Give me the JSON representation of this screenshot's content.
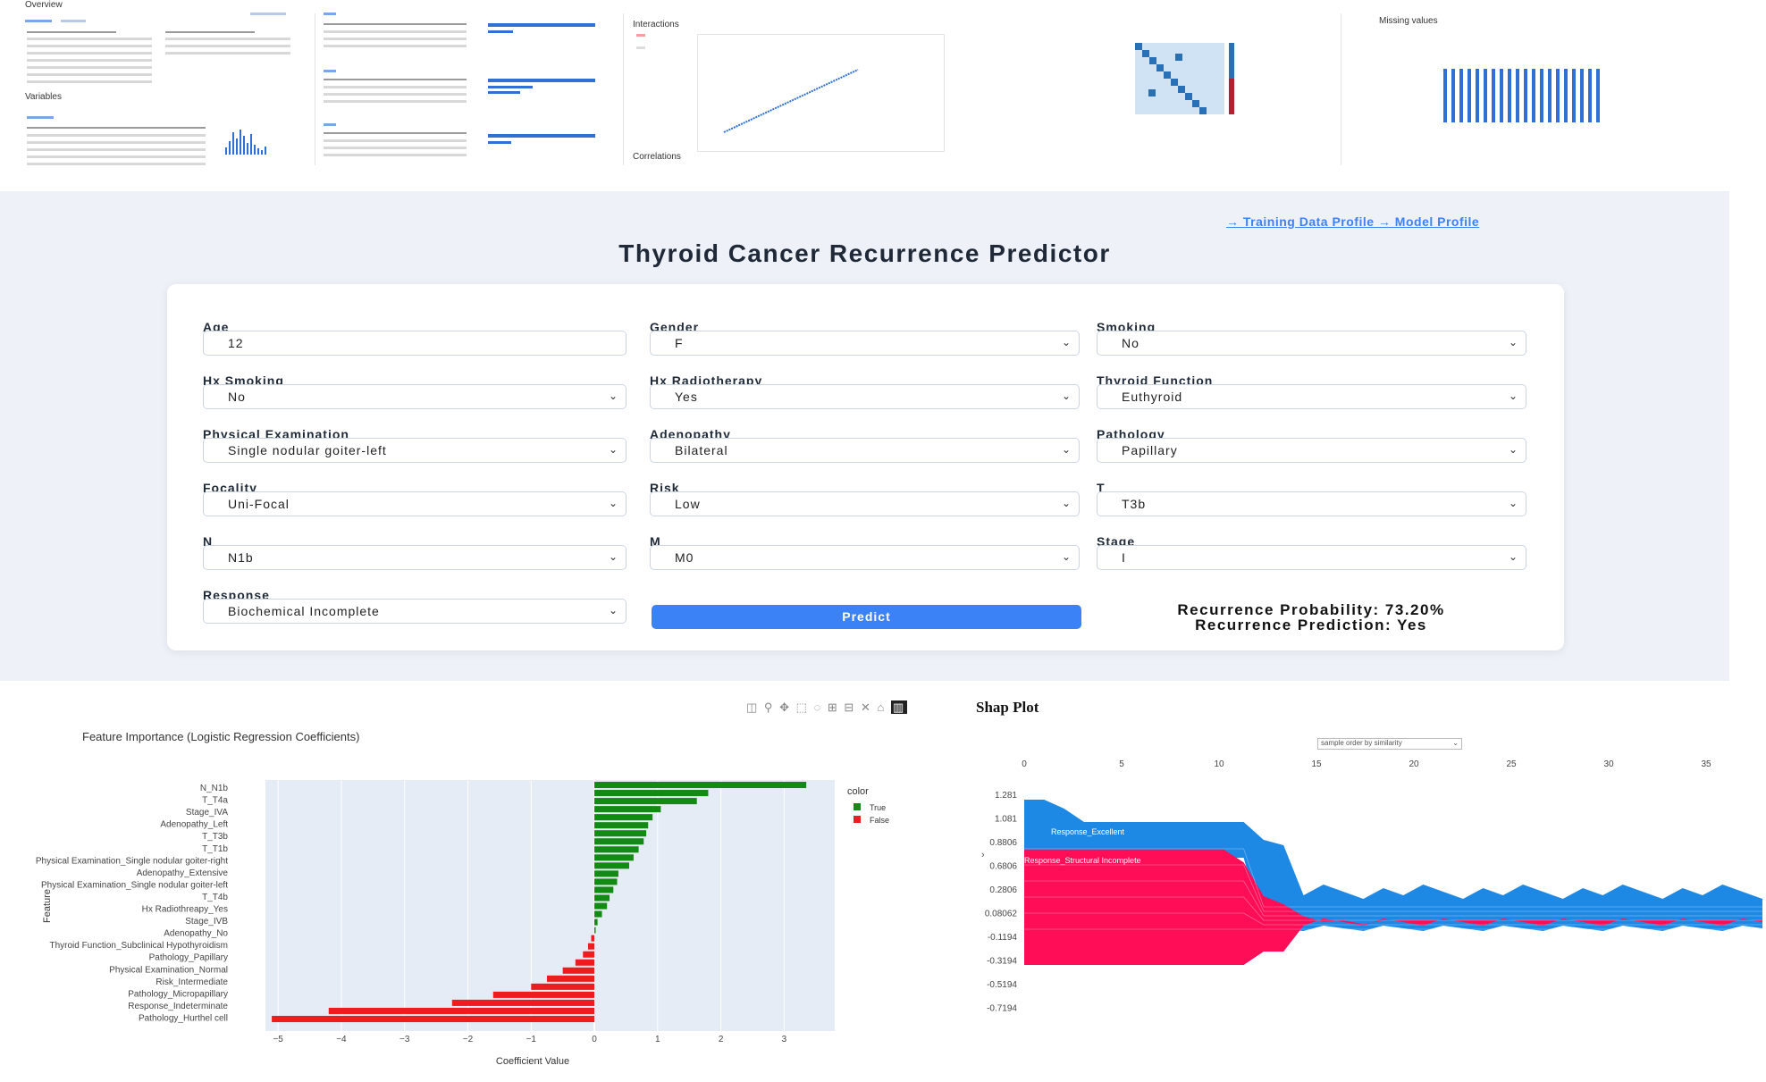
{
  "thumbnails": {
    "overview_title": "Overview",
    "variables_title": "Variables",
    "interactions_title": "Interactions",
    "correlations_title": "Correlations",
    "missing_title": "Missing values"
  },
  "header": {
    "nav_links": "→ Training Data Profile → Model Profile",
    "title": "Thyroid Cancer Recurrence Predictor"
  },
  "form": {
    "fields": [
      {
        "label": "Age",
        "value": "12",
        "type": "input"
      },
      {
        "label": "Gender",
        "value": "F",
        "type": "select"
      },
      {
        "label": "Smoking",
        "value": "No",
        "type": "select"
      },
      {
        "label": "Hx Smoking",
        "value": "No",
        "type": "select"
      },
      {
        "label": "Hx Radiotherapy",
        "value": "Yes",
        "type": "select"
      },
      {
        "label": "Thyroid Function",
        "value": "Euthyroid",
        "type": "select"
      },
      {
        "label": "Physical Examination",
        "value": "Single nodular goiter-left",
        "type": "select"
      },
      {
        "label": "Adenopathy",
        "value": "Bilateral",
        "type": "select"
      },
      {
        "label": "Pathology",
        "value": "Papillary",
        "type": "select"
      },
      {
        "label": "Focality",
        "value": "Uni-Focal",
        "type": "select"
      },
      {
        "label": "Risk",
        "value": "Low",
        "type": "select"
      },
      {
        "label": "T",
        "value": "T3b",
        "type": "select"
      },
      {
        "label": "N",
        "value": "N1b",
        "type": "select"
      },
      {
        "label": "M",
        "value": "M0",
        "type": "select"
      },
      {
        "label": "Stage",
        "value": "I",
        "type": "select"
      },
      {
        "label": "Response",
        "value": "Biochemical Incomplete",
        "type": "select"
      }
    ],
    "predict_label": "Predict",
    "result_probability": "Recurrence Probability: 73.20%",
    "result_prediction": "Recurrence Prediction: Yes"
  },
  "colors": {
    "accent": "#3b82f6",
    "panel_bg": "#eef2f8",
    "positive": "#138a13",
    "negative": "#ee1c1c",
    "shap_blue": "#1e88e5",
    "shap_red": "#ff0d57"
  },
  "chart_data": [
    {
      "type": "bar",
      "orientation": "horizontal",
      "title": "Feature Importance (Logistic Regression Coefficients)",
      "xlabel": "Coefficient Value",
      "ylabel": "Feature",
      "xlim": [
        -5.2,
        3.8
      ],
      "xticks": [
        -5,
        -4,
        -3,
        -2,
        -1,
        0,
        1,
        2,
        3
      ],
      "grid": true,
      "legend_position": "right",
      "legend_title": "color",
      "legend": [
        {
          "name": "True",
          "color": "#138a13"
        },
        {
          "name": "False",
          "color": "#ee1c1c"
        }
      ],
      "labeled_categories": [
        "N_N1b",
        "T_T4a",
        "Stage_IVA",
        "Adenopathy_Left",
        "T_T3b",
        "T_T1b",
        "Physical Examination_Single nodular goiter-right",
        "Adenopathy_Extensive",
        "Physical Examination_Single nodular goiter-left",
        "T_T4b",
        "Hx Radiothreapy_Yes",
        "Stage_IVB",
        "Adenopathy_No",
        "Thyroid Function_Subclinical Hypothyroidism",
        "Pathology_Papillary",
        "Physical Examination_Normal",
        "Risk_Intermediate",
        "Pathology_Micropapillary",
        "Response_Indeterminate",
        "Pathology_Hurthel cell"
      ],
      "values": [
        3.35,
        1.8,
        1.62,
        1.05,
        0.92,
        0.85,
        0.82,
        0.78,
        0.7,
        0.62,
        0.55,
        0.38,
        0.36,
        0.3,
        0.24,
        0.2,
        0.12,
        0.05,
        0.02,
        -0.05,
        -0.1,
        -0.18,
        -0.3,
        -0.5,
        -0.75,
        -1.0,
        -1.6,
        -2.25,
        -4.2,
        -5.1
      ]
    },
    {
      "type": "area",
      "title": "Shap Plot",
      "select_label": "sample order by similarity",
      "x_ticks": [
        0,
        5,
        10,
        15,
        20,
        25,
        30,
        35
      ],
      "y_tick_labels": [
        "1.281",
        "1.081",
        "0.8806",
        "0.6806",
        "0.2806",
        "0.08062",
        "-0.1194",
        "-0.3194",
        "-0.5194",
        "-0.7194"
      ],
      "annotations": [
        "Response_Excellent",
        "Response_Structural Incomplete"
      ],
      "series": [
        {
          "name": "Response_Excellent",
          "color": "#ff0d57",
          "values": [
            0.88,
            0.88,
            0.88,
            0.88,
            0.88,
            0.88,
            0.88,
            0.88,
            0.88,
            0.88,
            0.88,
            0.72,
            0.3,
            0.2,
            0.05,
            -0.02,
            0.0,
            -0.05,
            0.0,
            0.0,
            0.0,
            0.0,
            0.0,
            0.0,
            0.0,
            0.0,
            0.0,
            0.0,
            0.0,
            0.0,
            0.0,
            0.0,
            0.0,
            0.0,
            0.0,
            0.0,
            0.0,
            0.0
          ]
        }
      ]
    }
  ]
}
